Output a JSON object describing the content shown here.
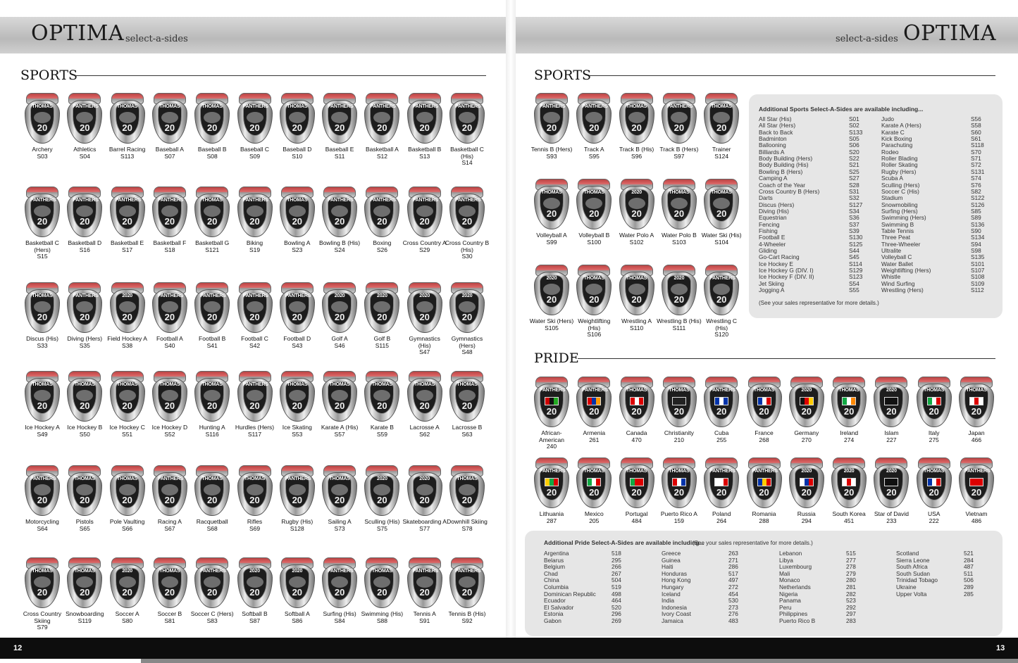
{
  "header": {
    "brand_left": "OPTIMA",
    "sub_left": "select-a-sides",
    "brand_right": "OPTIMA",
    "sub_right": "select-a-sides"
  },
  "left_page": {
    "section_title": "SPORTS",
    "rows": [
      [
        {
          "word": "THOMAS",
          "label": "Archery",
          "code": "S03"
        },
        {
          "word": "PANTHERS",
          "label": "Athletics",
          "code": "S04"
        },
        {
          "word": "THOMAS",
          "label": "Barrel Racing",
          "code": "S113"
        },
        {
          "word": "THOMAS",
          "label": "Baseball A",
          "code": "S07"
        },
        {
          "word": "THOMAS",
          "label": "Baseball B",
          "code": "S08"
        },
        {
          "word": "PANTHERS",
          "label": "Baseball C",
          "code": "S09"
        },
        {
          "word": "THOMAS",
          "label": "Baseball D",
          "code": "S10"
        },
        {
          "word": "PANTHERS",
          "label": "Baseball E",
          "code": "S11"
        },
        {
          "word": "PANTHERS",
          "label": "Basketball A",
          "code": "S12"
        },
        {
          "word": "PANTHERS",
          "label": "Basketball B",
          "code": "S13"
        },
        {
          "word": "PANTHERS",
          "label": "Basketball C (His)",
          "code": "S14"
        }
      ],
      [
        {
          "word": "PANTHERS",
          "label": "Basketball C (Hers)",
          "code": "S15"
        },
        {
          "word": "PANTHERS",
          "label": "Basketball D",
          "code": "S16"
        },
        {
          "word": "PANTHERS",
          "label": "Basketball E",
          "code": "S17"
        },
        {
          "word": "PANTHERS",
          "label": "Basketball F",
          "code": "S18"
        },
        {
          "word": "THOMAS",
          "label": "Basketball G",
          "code": "S121"
        },
        {
          "word": "PANTHERS",
          "label": "Biking",
          "code": "S19"
        },
        {
          "word": "THOMAS",
          "label": "Bowling A",
          "code": "S23"
        },
        {
          "word": "PANTHERS",
          "label": "Bowling B (His)",
          "code": "S24"
        },
        {
          "word": "PANTHERS",
          "label": "Boxing",
          "code": "S26"
        },
        {
          "word": "PANTHERS",
          "label": "Cross Country A",
          "code": "S29"
        },
        {
          "word": "PANTHERS",
          "label": "Cross Country B (His)",
          "code": "S30"
        }
      ],
      [
        {
          "word": "THOMAS",
          "label": "Discus (His)",
          "code": "S33"
        },
        {
          "word": "PANTHERS",
          "label": "Diving (Hers)",
          "code": "S35"
        },
        {
          "word": "2020",
          "label": "Field Hockey A",
          "code": "S38"
        },
        {
          "word": "PANTHERS",
          "label": "Football A",
          "code": "S40"
        },
        {
          "word": "PANTHERS",
          "label": "Football B",
          "code": "S41"
        },
        {
          "word": "PANTHERS",
          "label": "Football C",
          "code": "S42"
        },
        {
          "word": "PANTHERS",
          "label": "Football D",
          "code": "S43"
        },
        {
          "word": "2020",
          "label": "Golf A",
          "code": "S46"
        },
        {
          "word": "2020",
          "label": "Golf B",
          "code": "S115"
        },
        {
          "word": "2020",
          "label": "Gymnastics (His)",
          "code": "S47"
        },
        {
          "word": "2020",
          "label": "Gymnastics (Hers)",
          "code": "S48"
        }
      ],
      [
        {
          "word": "THOMAS",
          "label": "Ice Hockey A",
          "code": "S49"
        },
        {
          "word": "THOMAS",
          "label": "Ice Hockey B",
          "code": "S50"
        },
        {
          "word": "THOMAS",
          "label": "Ice Hockey C",
          "code": "S51"
        },
        {
          "word": "THOMAS",
          "label": "Ice Hockey D",
          "code": "S52"
        },
        {
          "word": "THOMAS",
          "label": "Hunting A",
          "code": "S116"
        },
        {
          "word": "PANTHERS",
          "label": "Hurdles (Hers)",
          "code": "S117"
        },
        {
          "word": "THOMAS",
          "label": "Ice Skating",
          "code": "S53"
        },
        {
          "word": "THOMAS",
          "label": "Karate A (His)",
          "code": "S57"
        },
        {
          "word": "THOMAS",
          "label": "Karate B",
          "code": "S59"
        },
        {
          "word": "THOMAS",
          "label": "Lacrosse A",
          "code": "S62"
        },
        {
          "word": "THOMAS",
          "label": "Lacrosse B",
          "code": "S63"
        }
      ],
      [
        {
          "word": "PANTHERS",
          "label": "Motorcycling",
          "code": "S64"
        },
        {
          "word": "THOMAS",
          "label": "Pistols",
          "code": "S65"
        },
        {
          "word": "THOMAS",
          "label": "Pole Vaulting",
          "code": "S66"
        },
        {
          "word": "PANTHERS",
          "label": "Racing A",
          "code": "S67"
        },
        {
          "word": "THOMAS",
          "label": "Racquetball",
          "code": "S68"
        },
        {
          "word": "THOMAS",
          "label": "Rifles",
          "code": "S69"
        },
        {
          "word": "PANTHERS",
          "label": "Rugby (His)",
          "code": "S128"
        },
        {
          "word": "THOMAS",
          "label": "Sailing A",
          "code": "S73"
        },
        {
          "word": "2020",
          "label": "Sculling (His)",
          "code": "S75"
        },
        {
          "word": "2020",
          "label": "Skateboarding A",
          "code": "S77"
        },
        {
          "word": "THOMAS",
          "label": "Downhill Skiing",
          "code": "S78"
        }
      ],
      [
        {
          "word": "THOMAS",
          "label": "Cross Country Skiing",
          "code": "S79"
        },
        {
          "word": "THOMAS",
          "label": "Snowboarding",
          "code": "S119"
        },
        {
          "word": "2020",
          "label": "Soccer A",
          "code": "S80"
        },
        {
          "word": "THOMAS",
          "label": "Soccer B",
          "code": "S81"
        },
        {
          "word": "PANTHERS",
          "label": "Soccer C (Hers)",
          "code": "S83"
        },
        {
          "word": "2020",
          "label": "Softball B",
          "code": "S87"
        },
        {
          "word": "2020",
          "label": "Softball A",
          "code": "S86"
        },
        {
          "word": "PANTHERS",
          "label": "Surfing (His)",
          "code": "S84"
        },
        {
          "word": "THOMAS",
          "label": "Swimming (His)",
          "code": "S88"
        },
        {
          "word": "PANTHERS",
          "label": "Tennis A",
          "code": "S91"
        },
        {
          "word": "PANTHERS",
          "label": "Tennis B (His)",
          "code": "S92"
        }
      ]
    ]
  },
  "right_page": {
    "section_title": "SPORTS",
    "rows": [
      [
        {
          "word": "PANTHERS",
          "label": "Tennis B (Hers)",
          "code": "S93"
        },
        {
          "word": "PANTHERS",
          "label": "Track A",
          "code": "S95"
        },
        {
          "word": "THOMAS",
          "label": "Track B (His)",
          "code": "S96"
        },
        {
          "word": "PANTHERS",
          "label": "Track B (Hers)",
          "code": "S97"
        },
        {
          "word": "THOMAS",
          "label": "Trainer",
          "code": "S124"
        }
      ],
      [
        {
          "word": "THOMAS",
          "label": "Volleyball A",
          "code": "S99"
        },
        {
          "word": "THOMAS",
          "label": "Volleyball B",
          "code": "S100"
        },
        {
          "word": "2020",
          "label": "Water Polo A",
          "code": "S102"
        },
        {
          "word": "THOMAS",
          "label": "Water Polo B",
          "code": "S103"
        },
        {
          "word": "THOMAS",
          "label": "Water Ski (His)",
          "code": "S104"
        }
      ],
      [
        {
          "word": "2020",
          "label": "Water Ski (Hers)",
          "code": "S105"
        },
        {
          "word": "THOMAS",
          "label": "Weightlifting (His)",
          "code": "S106"
        },
        {
          "word": "THOMAS",
          "label": "Wrestling A",
          "code": "S110"
        },
        {
          "word": "2020",
          "label": "Wrestling B (His)",
          "code": "S111"
        },
        {
          "word": "PANTHERS",
          "label": "Wrestling C (His)",
          "code": "S120"
        }
      ]
    ],
    "additional_sports": {
      "title": "Additional Sports Select-A-Sides are available including...",
      "col1": [
        [
          "All Star (His)",
          "S01"
        ],
        [
          "All Star (Hers)",
          "S02"
        ],
        [
          "Back to Back",
          "S133"
        ],
        [
          "Badminton",
          "S05"
        ],
        [
          "Ballooning",
          "S06"
        ],
        [
          "Billiards A",
          "S20"
        ],
        [
          "Body Building (Hers)",
          "S22"
        ],
        [
          "Body Building (His)",
          "S21"
        ],
        [
          "Bowling B (Hers)",
          "S25"
        ],
        [
          "Camping A",
          "S27"
        ],
        [
          "Coach of the Year",
          "S28"
        ],
        [
          "Cross Country B (Hers)",
          "S31"
        ],
        [
          "Darts",
          "S32"
        ],
        [
          "Discus (Hers)",
          "S127"
        ],
        [
          "Diving (His)",
          "S34"
        ],
        [
          "Equestrian",
          "S36"
        ],
        [
          "Fencing",
          "S37"
        ],
        [
          "Fishing",
          "S39"
        ],
        [
          "Football E",
          "S130"
        ],
        [
          "4-Wheeler",
          "S125"
        ],
        [
          "Gliding",
          "S44"
        ],
        [
          "Go-Cart Racing",
          "S45"
        ],
        [
          "Ice Hockey E",
          "S114"
        ],
        [
          "Ice Hockey G (DIV. I)",
          "S129"
        ],
        [
          "Ice Hockey F (DIV. II)",
          "S123"
        ],
        [
          "Jet Skiing",
          "S54"
        ],
        [
          "Jogging A",
          "S55"
        ]
      ],
      "col2": [
        [
          "Judo",
          "S56"
        ],
        [
          "Karate A (Hers)",
          "S58"
        ],
        [
          "Karate C",
          "S60"
        ],
        [
          "Kick Boxing",
          "S61"
        ],
        [
          "Parachuting",
          "S118"
        ],
        [
          "Rodeo",
          "S70"
        ],
        [
          "Roller Blading",
          "S71"
        ],
        [
          "Roller Skating",
          "S72"
        ],
        [
          "Rugby (Hers)",
          "S131"
        ],
        [
          "Scuba A",
          "S74"
        ],
        [
          "Sculling (Hers)",
          "S76"
        ],
        [
          "Soccer C (His)",
          "S82"
        ],
        [
          "Stadium",
          "S122"
        ],
        [
          "Snowmobiling",
          "S126"
        ],
        [
          "Surfing (Hers)",
          "S85"
        ],
        [
          "Swimming (Hers)",
          "S89"
        ],
        [
          "Swimming B",
          "S136"
        ],
        [
          "Table Tennis",
          "S90"
        ],
        [
          "Three Peat",
          "S134"
        ],
        [
          "Three-Wheeler",
          "S94"
        ],
        [
          "Ultralite",
          "S98"
        ],
        [
          "Volleyball C",
          "S135"
        ],
        [
          "Water Ballet",
          "S101"
        ],
        [
          "Weightlifting (Hers)",
          "S107"
        ],
        [
          "Whistle",
          "S108"
        ],
        [
          "Wind Surfing",
          "S109"
        ],
        [
          "Wrestling (Hers)",
          "S112"
        ]
      ],
      "note": "(See your sales representative for more details.)"
    },
    "pride_title": "PRIDE",
    "pride_rows": [
      [
        {
          "word": "PANTHERS",
          "label": "African-American",
          "code": "240",
          "flag": [
            "#c00",
            "#111",
            "#2a2"
          ]
        },
        {
          "word": "PANTHERS",
          "label": "Armenia",
          "code": "261",
          "flag": [
            "#d00",
            "#03a",
            "#f90"
          ]
        },
        {
          "word": "THOMAS",
          "label": "Canada",
          "code": "470",
          "flag": [
            "#d00",
            "#fff",
            "#d00"
          ]
        },
        {
          "word": "THOMAS",
          "label": "Christianity",
          "code": "210",
          "flag": [
            "#222",
            "#222",
            "#222"
          ]
        },
        {
          "word": "PANTHERS",
          "label": "Cuba",
          "code": "255",
          "flag": [
            "#03a",
            "#fff",
            "#03a"
          ]
        },
        {
          "word": "THOMAS",
          "label": "France",
          "code": "268",
          "flag": [
            "#03a",
            "#fff",
            "#d00"
          ]
        },
        {
          "word": "2020",
          "label": "Germany",
          "code": "270",
          "flag": [
            "#111",
            "#d00",
            "#fc0"
          ]
        },
        {
          "word": "THOMAS",
          "label": "Ireland",
          "code": "274",
          "flag": [
            "#1a4",
            "#fff",
            "#f80"
          ]
        },
        {
          "word": "2020",
          "label": "Islam",
          "code": "227",
          "flag": [
            "#111",
            "#111",
            "#111"
          ]
        },
        {
          "word": "THOMAS",
          "label": "Italy",
          "code": "275",
          "flag": [
            "#1a4",
            "#fff",
            "#d00"
          ]
        },
        {
          "word": "THOMAS",
          "label": "Japan",
          "code": "466",
          "flag": [
            "#fff",
            "#d00",
            "#fff"
          ]
        }
      ],
      [
        {
          "word": "PANTHERS",
          "label": "Lithuania",
          "code": "287",
          "flag": [
            "#fc0",
            "#1a4",
            "#d00"
          ]
        },
        {
          "word": "THOMAS",
          "label": "Mexico",
          "code": "205",
          "flag": [
            "#1a4",
            "#fff",
            "#d00"
          ]
        },
        {
          "word": "THOMAS",
          "label": "Portugal",
          "code": "484",
          "flag": [
            "#1a4",
            "#d00",
            "#d00"
          ]
        },
        {
          "word": "THOMAS",
          "label": "Puerto Rico A",
          "code": "159",
          "flag": [
            "#d00",
            "#fff",
            "#03a"
          ]
        },
        {
          "word": "PANTHERS",
          "label": "Poland",
          "code": "264",
          "flag": [
            "#fff",
            "#fff",
            "#d00"
          ]
        },
        {
          "word": "PANTHERS",
          "label": "Romania",
          "code": "288",
          "flag": [
            "#03a",
            "#fc0",
            "#d00"
          ]
        },
        {
          "word": "2020",
          "label": "Russia",
          "code": "294",
          "flag": [
            "#fff",
            "#03a",
            "#d00"
          ]
        },
        {
          "word": "2020",
          "label": "South Korea",
          "code": "451",
          "flag": [
            "#fff",
            "#d00",
            "#fff"
          ]
        },
        {
          "word": "2020",
          "label": "Star of David",
          "code": "233",
          "flag": [
            "#111",
            "#111",
            "#111"
          ]
        },
        {
          "word": "THOMAS",
          "label": "USA",
          "code": "222",
          "flag": [
            "#03a",
            "#fff",
            "#d00"
          ]
        },
        {
          "word": "PANTHERS",
          "label": "Vietnam",
          "code": "486",
          "flag": [
            "#d00",
            "#d00",
            "#d00"
          ]
        }
      ]
    ],
    "additional_pride": {
      "title": "Additional Pride Select-A-Sides are available including...",
      "note": "(See your sales representative for more details.)",
      "col1": [
        [
          "Argentina",
          "518"
        ],
        [
          "Belarus",
          "295"
        ],
        [
          "Belgium",
          "266"
        ],
        [
          "Chad",
          "267"
        ],
        [
          "China",
          "504"
        ],
        [
          "Columbia",
          "519"
        ],
        [
          "Dominican Republic",
          "498"
        ],
        [
          "Ecuador",
          "464"
        ],
        [
          "El Salvador",
          "520"
        ],
        [
          "Estonia",
          "296"
        ],
        [
          "Gabon",
          "269"
        ]
      ],
      "col2": [
        [
          "Greece",
          "263"
        ],
        [
          "Guinea",
          "271"
        ],
        [
          "Haiti",
          "286"
        ],
        [
          "Honduras",
          "517"
        ],
        [
          "Hong Kong",
          "497"
        ],
        [
          "Hungary",
          "272"
        ],
        [
          "Iceland",
          "454"
        ],
        [
          "India",
          "530"
        ],
        [
          "Indonesia",
          "273"
        ],
        [
          "Ivory Coast",
          "276"
        ],
        [
          "Jamaica",
          "483"
        ]
      ],
      "col3": [
        [
          "Lebanon",
          "515"
        ],
        [
          "Libya",
          "277"
        ],
        [
          "Luxembourg",
          "278"
        ],
        [
          "Mali",
          "279"
        ],
        [
          "Monaco",
          "280"
        ],
        [
          "Netherlands",
          "281"
        ],
        [
          "Nigeria",
          "282"
        ],
        [
          "Panama",
          "523"
        ],
        [
          "Peru",
          "292"
        ],
        [
          "Philippines",
          "297"
        ],
        [
          "Puerto Rico B",
          "283"
        ]
      ],
      "col4": [
        [
          "Scotland",
          "521"
        ],
        [
          "Sierra Leone",
          "284"
        ],
        [
          "South Africa",
          "487"
        ],
        [
          "South Sudan",
          "511"
        ],
        [
          "Trinidad Tobago",
          "506"
        ],
        [
          "Ukraine",
          "289"
        ],
        [
          "Upper Volta",
          "285"
        ]
      ]
    }
  },
  "footer": {
    "page_left": "12",
    "page_right": "13"
  }
}
